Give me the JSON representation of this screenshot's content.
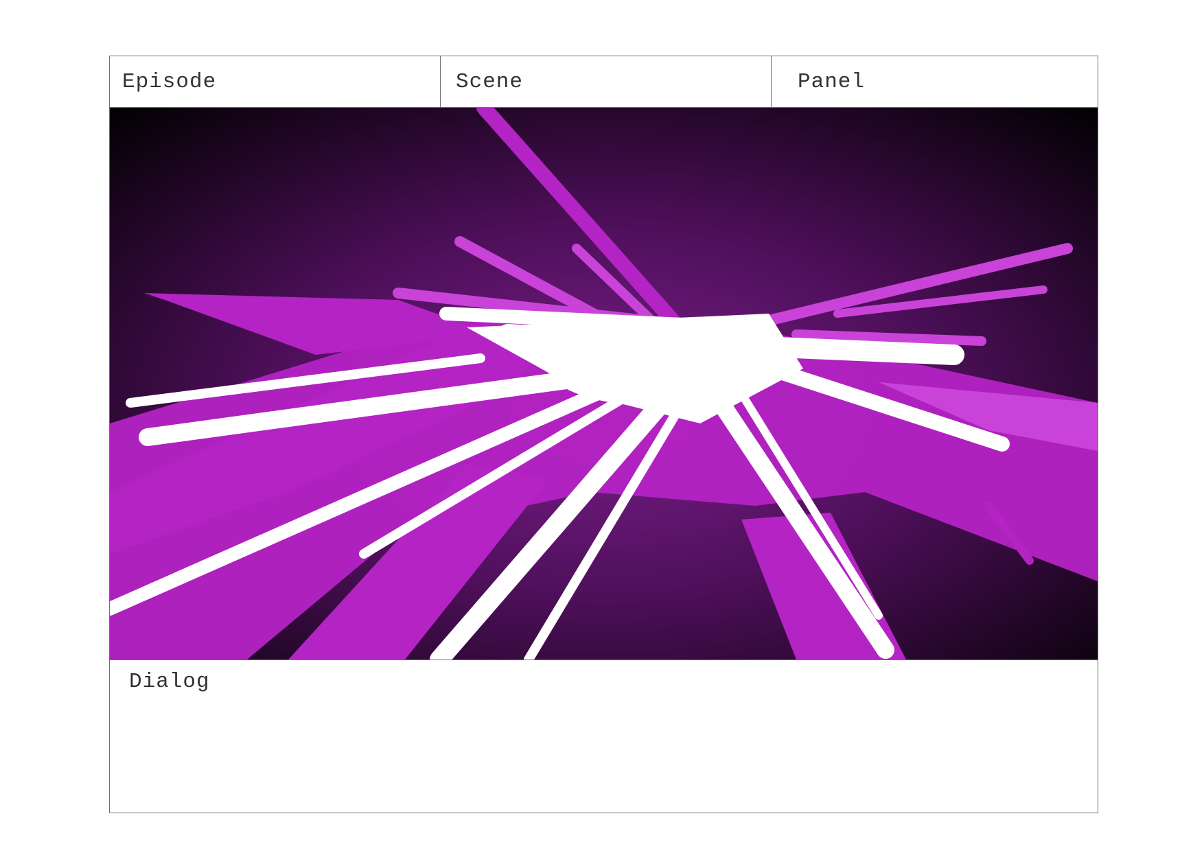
{
  "header": {
    "episode_label": "Episode",
    "scene_label": "Scene",
    "panel_label": "Panel"
  },
  "dialog": {
    "label": "Dialog"
  },
  "artwork": {
    "subject": "white and magenta energy burst over dark purple background",
    "colors": {
      "background_dark": "#000000",
      "background_glow": "#6a1a78",
      "magenta": "#b423c4",
      "light_magenta": "#c943d8",
      "highlight": "#ffffff"
    }
  }
}
